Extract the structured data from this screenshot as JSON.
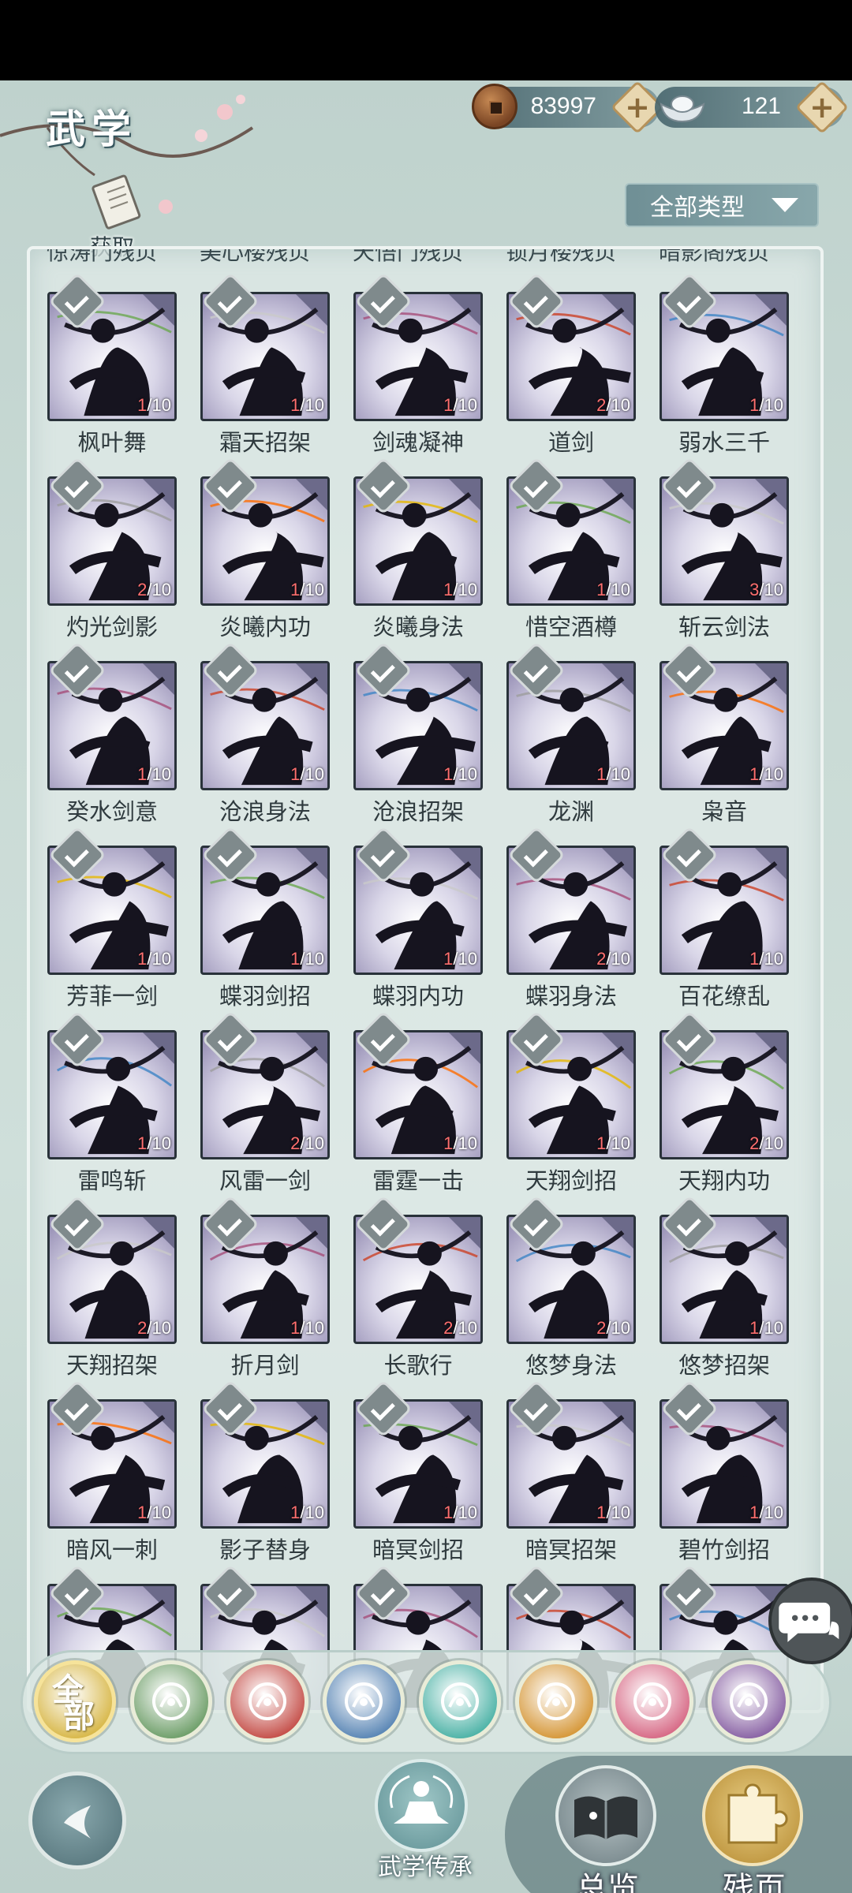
{
  "header": {
    "title": "武学",
    "copper": {
      "icon": "copper-coin-icon",
      "value": "83997"
    },
    "silver": {
      "icon": "silver-ingot-icon",
      "value": "121"
    }
  },
  "toolbar": {
    "acquire_label": "获取",
    "filter_label": "全部类型"
  },
  "cut_labels": [
    "惊涛门残页",
    "美心楼残页",
    "天悟门残页",
    "锁月楼残页",
    "暗影阁残页"
  ],
  "skills": [
    {
      "name": "枫叶舞",
      "have": "1",
      "total": "/10"
    },
    {
      "name": "霜天招架",
      "have": "1",
      "total": "/10"
    },
    {
      "name": "剑魂凝神",
      "have": "1",
      "total": "/10"
    },
    {
      "name": "道剑",
      "have": "2",
      "total": "/10"
    },
    {
      "name": "弱水三千",
      "have": "1",
      "total": "/10"
    },
    {
      "name": "灼光剑影",
      "have": "2",
      "total": "/10"
    },
    {
      "name": "炎曦内功",
      "have": "1",
      "total": "/10"
    },
    {
      "name": "炎曦身法",
      "have": "1",
      "total": "/10"
    },
    {
      "name": "惜空酒樽",
      "have": "1",
      "total": "/10"
    },
    {
      "name": "斩云剑法",
      "have": "3",
      "total": "/10"
    },
    {
      "name": "癸水剑意",
      "have": "1",
      "total": "/10"
    },
    {
      "name": "沧浪身法",
      "have": "1",
      "total": "/10"
    },
    {
      "name": "沧浪招架",
      "have": "1",
      "total": "/10"
    },
    {
      "name": "龙渊",
      "have": "1",
      "total": "/10"
    },
    {
      "name": "枭音",
      "have": "1",
      "total": "/10"
    },
    {
      "name": "芳菲一剑",
      "have": "1",
      "total": "/10"
    },
    {
      "name": "蝶羽剑招",
      "have": "1",
      "total": "/10"
    },
    {
      "name": "蝶羽内功",
      "have": "1",
      "total": "/10"
    },
    {
      "name": "蝶羽身法",
      "have": "2",
      "total": "/10"
    },
    {
      "name": "百花缭乱",
      "have": "1",
      "total": "/10"
    },
    {
      "name": "雷鸣斩",
      "have": "1",
      "total": "/10"
    },
    {
      "name": "风雷一剑",
      "have": "2",
      "total": "/10"
    },
    {
      "name": "雷霆一击",
      "have": "1",
      "total": "/10"
    },
    {
      "name": "天翔剑招",
      "have": "1",
      "total": "/10"
    },
    {
      "name": "天翔内功",
      "have": "2",
      "total": "/10"
    },
    {
      "name": "天翔招架",
      "have": "2",
      "total": "/10"
    },
    {
      "name": "折月剑",
      "have": "1",
      "total": "/10"
    },
    {
      "name": "长歌行",
      "have": "2",
      "total": "/10"
    },
    {
      "name": "悠梦身法",
      "have": "2",
      "total": "/10"
    },
    {
      "name": "悠梦招架",
      "have": "1",
      "total": "/10"
    },
    {
      "name": "暗风一刺",
      "have": "1",
      "total": "/10"
    },
    {
      "name": "影子替身",
      "have": "1",
      "total": "/10"
    },
    {
      "name": "暗冥剑招",
      "have": "1",
      "total": "/10"
    },
    {
      "name": "暗冥招架",
      "have": "1",
      "total": "/10"
    },
    {
      "name": "碧竹剑招",
      "have": "1",
      "total": "/10"
    }
  ],
  "categories": {
    "all_label_top": "全",
    "all_label_bottom": "部",
    "items": [
      {
        "icon": "all-icon",
        "color": "#d8b84a"
      },
      {
        "icon": "sword-icon",
        "color": "#6f9f6a"
      },
      {
        "icon": "flame-icon",
        "color": "#c5504a"
      },
      {
        "icon": "wave-icon",
        "color": "#5a86b5"
      },
      {
        "icon": "butterfly-icon",
        "color": "#4eb3a7"
      },
      {
        "icon": "shield-icon",
        "color": "#d6983a"
      },
      {
        "icon": "moon-icon",
        "color": "#d76a86"
      },
      {
        "icon": "rose-icon",
        "color": "#8a64a5"
      }
    ]
  },
  "bottom_nav": {
    "legacy_label": "武学传承",
    "overview_label": "总览",
    "fragment_label": "残页"
  }
}
